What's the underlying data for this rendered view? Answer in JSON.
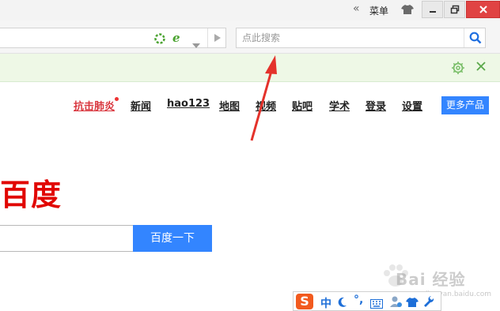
{
  "titlebar": {
    "more_glyph": "«",
    "menu_label": "菜单",
    "skin_icon": "shirt-icon",
    "minimize_icon": "minimize-icon",
    "restore_icon": "restore-icon",
    "close_icon": "close-icon",
    "close_color": "#e04343"
  },
  "toolbar": {
    "address_value": "",
    "search_placeholder": "点此搜索",
    "icons": [
      "security-icon",
      "ie-mode-icon",
      "dropdown-icon",
      "go-icon",
      "search-icon"
    ]
  },
  "infobar": {
    "background": "#eef8e6",
    "icons": [
      "gear-icon",
      "close-icon"
    ]
  },
  "page": {
    "nav": {
      "hot": "抗击肺炎",
      "news": "新闻",
      "hao123": "hao123",
      "map": "地图",
      "video": "视频",
      "tieba": "贴吧",
      "xueshu": "学术",
      "login": "登录",
      "settings": "设置",
      "more": "更多产品"
    },
    "logo_text": "百度",
    "search_value": "",
    "search_button": "百度一下",
    "accent": "#3385ff",
    "logo_color": "#e10602"
  },
  "ime": {
    "logo_letter": "S",
    "mode": "中",
    "punct": "°,",
    "icons": [
      "sogou-logo-icon",
      "half-moon-icon",
      "keyboard-icon",
      "user-icon",
      "skin-icon",
      "tools-icon"
    ]
  },
  "watermark": {
    "text": "Bai 经验",
    "sub": "jingyan.baidu.com"
  }
}
